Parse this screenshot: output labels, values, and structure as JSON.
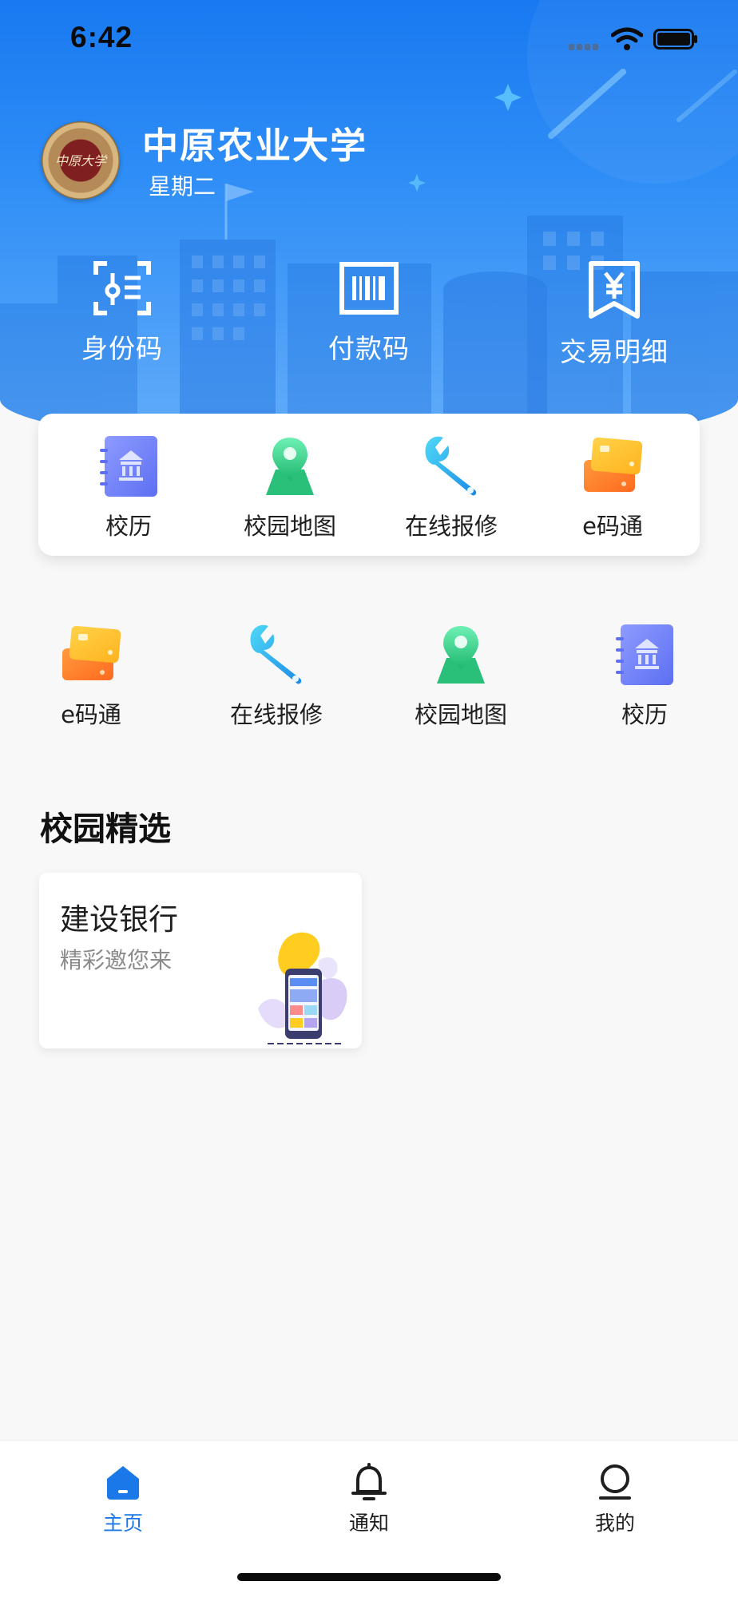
{
  "status_bar": {
    "time": "6:42"
  },
  "header": {
    "school_name": "中原农业大学",
    "weekday": "星期二",
    "logo_text": "中原大学"
  },
  "top_actions": [
    {
      "label": "身份码",
      "icon": "id-code-icon"
    },
    {
      "label": "付款码",
      "icon": "barcode-icon"
    },
    {
      "label": "交易明细",
      "icon": "yuan-receipt-icon"
    }
  ],
  "quick_services": [
    {
      "label": "校历",
      "icon": "calendar-book-icon"
    },
    {
      "label": "校园地图",
      "icon": "map-pin-icon"
    },
    {
      "label": "在线报修",
      "icon": "wrench-icon"
    },
    {
      "label": "e码通",
      "icon": "cards-icon"
    }
  ],
  "recent_services": [
    {
      "label": "e码通",
      "icon": "cards-icon"
    },
    {
      "label": "在线报修",
      "icon": "wrench-icon"
    },
    {
      "label": "校园地图",
      "icon": "map-pin-icon"
    },
    {
      "label": "校历",
      "icon": "calendar-book-icon"
    }
  ],
  "featured": {
    "title": "校园精选",
    "cards": [
      {
        "title": "建设银行",
        "subtitle": "精彩邀您来"
      }
    ]
  },
  "tabbar": {
    "items": [
      {
        "label": "主页",
        "icon": "home-icon",
        "active": true
      },
      {
        "label": "通知",
        "icon": "bell-icon",
        "active": false
      },
      {
        "label": "我的",
        "icon": "profile-icon",
        "active": false
      }
    ]
  },
  "colors": {
    "primary": "#1879f1",
    "active_tab": "#1a78e8",
    "header_light": "#63adfa"
  }
}
